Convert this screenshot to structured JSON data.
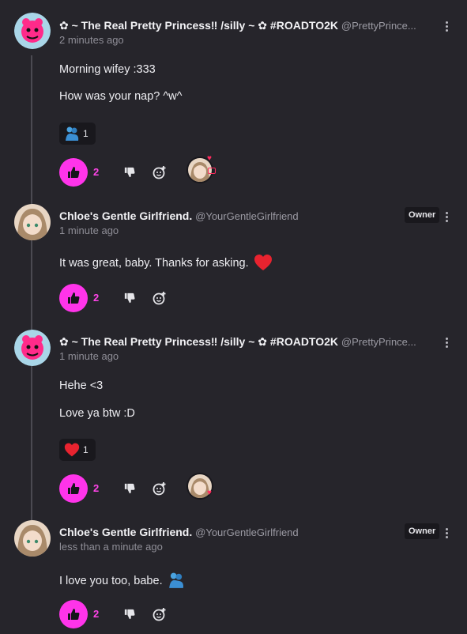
{
  "comments": [
    {
      "author": "✿ ~ The Real Pretty Princess‼ /silly ~ ✿ #ROADTO2K",
      "handle": "@PrettyPrince...",
      "time": "2 minutes ago",
      "lines": [
        "Morning wifey :333",
        "How was your nap? ^w^"
      ],
      "reaction": {
        "icon": "people-hugging-icon",
        "count": "1"
      },
      "likes": "2"
    },
    {
      "author": "Chloe's Gentle Girlfriend.",
      "handle": "@YourGentleGirlfriend",
      "badge": "Owner",
      "time": "1 minute ago",
      "lines": [
        "It was great, baby. Thanks for asking."
      ],
      "likes": "2"
    },
    {
      "author": "✿ ~ The Real Pretty Princess‼ /silly ~ ✿ #ROADTO2K",
      "handle": "@PrettyPrince...",
      "time": "1 minute ago",
      "lines": [
        "Hehe <3",
        "Love ya btw :D"
      ],
      "reaction": {
        "icon": "red-heart-icon",
        "count": "1"
      },
      "likes": "2"
    },
    {
      "author": "Chloe's Gentle Girlfriend.",
      "handle": "@YourGentleGirlfriend",
      "badge": "Owner",
      "time": "less than a minute ago",
      "lines": [
        "I love you too, babe."
      ],
      "likes": "2"
    }
  ],
  "colors": {
    "accent": "#ff34ea",
    "heart": "#e8232f",
    "background": "#26252b"
  }
}
